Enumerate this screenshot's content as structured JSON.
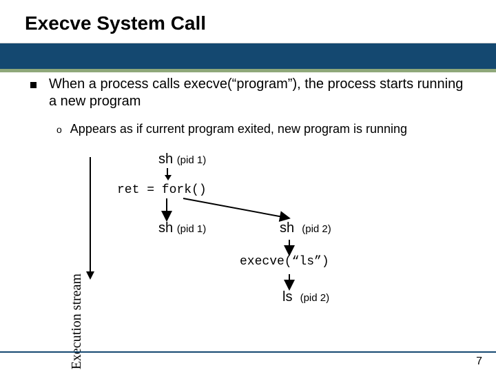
{
  "title": "Execve System Call",
  "bullet": "When a process calls execve(“program”), the process starts running a new program",
  "subbullet": "Appears as if current program exited, new program is running",
  "axis_label": "Execution  stream",
  "sh_label": "sh",
  "ls_label": "ls",
  "pid1": "(pid 1)",
  "pid2": "(pid 2)",
  "fork_line": "ret = fork()",
  "exec_line": "execve(“ls”)",
  "o_glyph": "o",
  "page": "7"
}
